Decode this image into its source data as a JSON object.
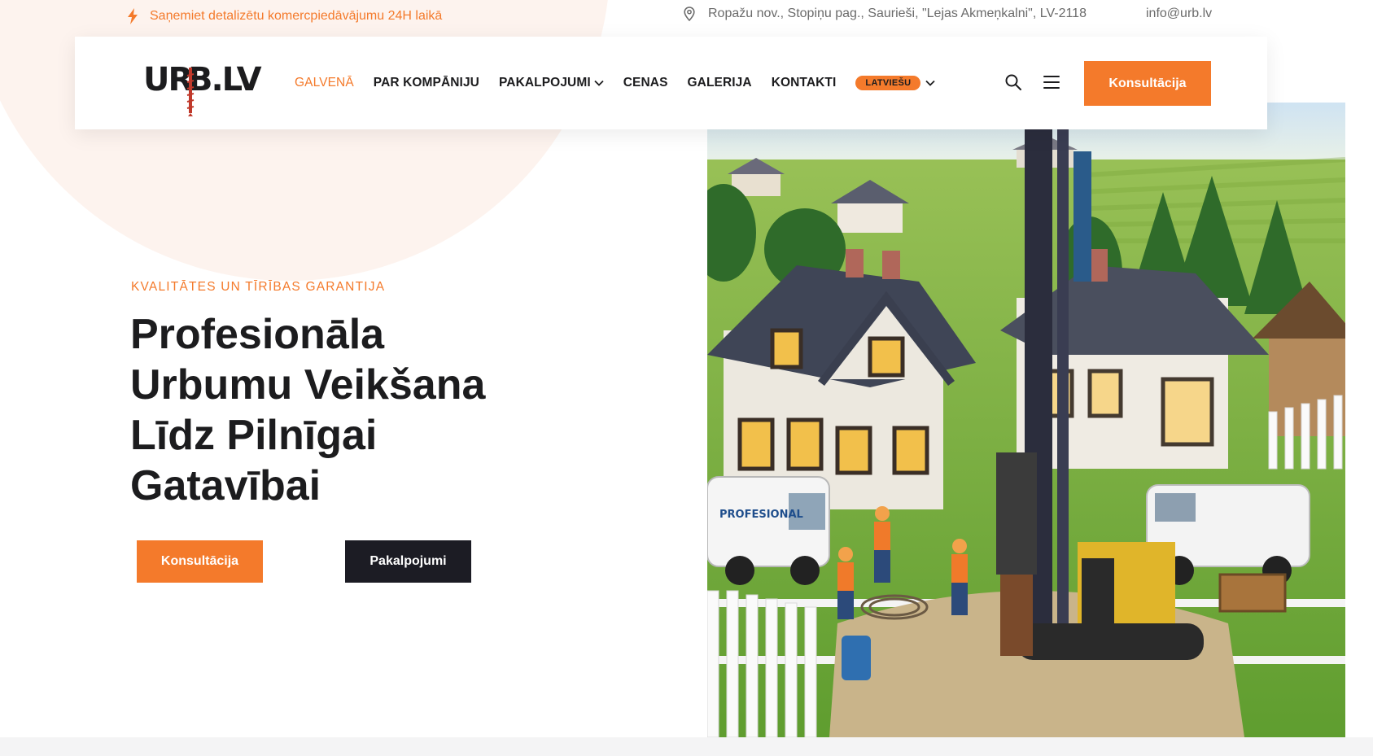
{
  "topbar": {
    "promo_text": "Saņemiet detalizētu komercpiedāvājumu 24H laikā",
    "address": "Ropažu nov., Stopiņu pag., Saurieši, \"Lejas Akmeņkalni\", LV-2118",
    "email": "info@urb.lv"
  },
  "header": {
    "logo_text": "URB.LV",
    "nav": [
      {
        "label": "GALVENĀ",
        "active": true
      },
      {
        "label": "PAR KOMPĀNIJU"
      },
      {
        "label": "PAKALPOJUMI",
        "dropdown": true
      },
      {
        "label": "CENAS"
      },
      {
        "label": "GALERIJA"
      },
      {
        "label": "KONTAKTI"
      }
    ],
    "language": "LATVIEŠU",
    "cta_label": "Konsultācija"
  },
  "hero": {
    "kicker": "KVALITĀTES UN TĪRĪBAS GARANTIJA",
    "title_lines": [
      "Profesionāla",
      "Urbumu Veikšana",
      "Līdz Pilnīgai",
      "Gatavībai"
    ],
    "primary_button": "Konsultācija",
    "secondary_button": "Pakalpojumi",
    "image_van_text": "PROFESIONAL"
  },
  "colors": {
    "accent": "#f47a2b",
    "dark": "#1c1c24",
    "text": "#1c1c1e",
    "muted": "#6b6b6b"
  },
  "icons": [
    "bolt-icon",
    "location-pin-icon",
    "search-icon",
    "menu-icon",
    "chevron-down-icon"
  ]
}
